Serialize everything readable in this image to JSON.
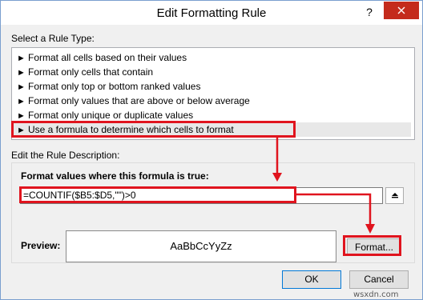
{
  "window": {
    "title": "Edit Formatting Rule",
    "help_glyph": "?",
    "close_icon": "close-icon"
  },
  "rule_type": {
    "label": "Select a Rule Type:",
    "items": [
      {
        "label": "Format all cells based on their values"
      },
      {
        "label": "Format only cells that contain"
      },
      {
        "label": "Format only top or bottom ranked values"
      },
      {
        "label": "Format only values that are above or below average"
      },
      {
        "label": "Format only unique or duplicate values"
      },
      {
        "label": "Use a formula to determine which cells to format"
      }
    ],
    "selected_index": 5,
    "arrow_glyph": "►"
  },
  "description": {
    "label": "Edit the Rule Description:",
    "formula_label": "Format values where this formula is true:",
    "formula_value": "=COUNTIF($B5:$D5,\"\")>0",
    "preview_label": "Preview:",
    "preview_text": "AaBbCcYyZz",
    "format_button": "Format..."
  },
  "footer": {
    "ok": "OK",
    "cancel": "Cancel"
  },
  "annotations": {
    "highlight_color": "#e0141e"
  },
  "watermark": "wsxdn.com"
}
